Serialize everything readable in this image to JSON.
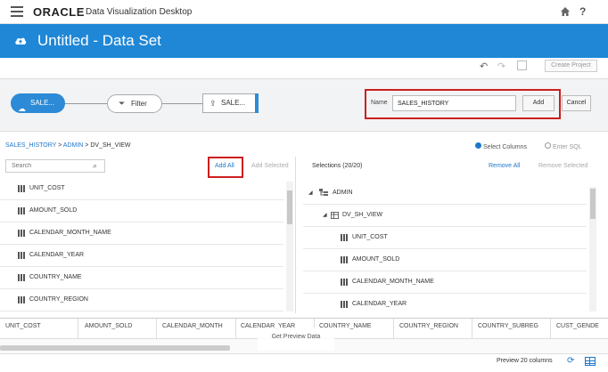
{
  "app": {
    "brand": "ORACLE",
    "product": "Data Visualization Desktop",
    "title": "Untitled - Data Set"
  },
  "toolbar": {
    "create_project": "Create Project"
  },
  "flow": {
    "source_label": "SALE...",
    "filter_label": "Filter",
    "target_label": "SALE...",
    "name_label": "Name",
    "name_value": "SALES_HISTORY",
    "add_label": "Add",
    "cancel_label": "Cancel"
  },
  "breadcrumb": {
    "part1": "SALES_HISTORY",
    "sep1": " > ",
    "part2": "ADMIN",
    "sep2": " > ",
    "part3": "DV_SH_VIEW"
  },
  "mode": {
    "select_columns": "Select Columns",
    "enter_sql": "Enter SQL"
  },
  "left": {
    "search_placeholder": "Search",
    "add_all": "Add All",
    "add_selected": "Add Selected",
    "columns": [
      "UNIT_COST",
      "AMOUNT_SOLD",
      "CALENDAR_MONTH_NAME",
      "CALENDAR_YEAR",
      "COUNTRY_NAME",
      "COUNTRY_REGION"
    ]
  },
  "right": {
    "selections": "Selections (20/20)",
    "remove_all": "Remove All",
    "remove_selected": "Remove Selected",
    "schema": "ADMIN",
    "view": "DV_SH_VIEW",
    "columns": [
      "UNIT_COST",
      "AMOUNT_SOLD",
      "CALENDAR_MONTH_NAME",
      "CALENDAR_YEAR"
    ]
  },
  "preview": {
    "headers": [
      "UNIT_COST",
      "AMOUNT_SOLD",
      "CALENDAR_MONTH",
      "CALENDAR_YEAR",
      "COUNTRY_NAME",
      "COUNTRY_REGION",
      "COUNTRY_SUBREG",
      "CUST_GENDE"
    ],
    "get_preview": "Get Preview Data",
    "count_label": "Preview 20 columns"
  }
}
